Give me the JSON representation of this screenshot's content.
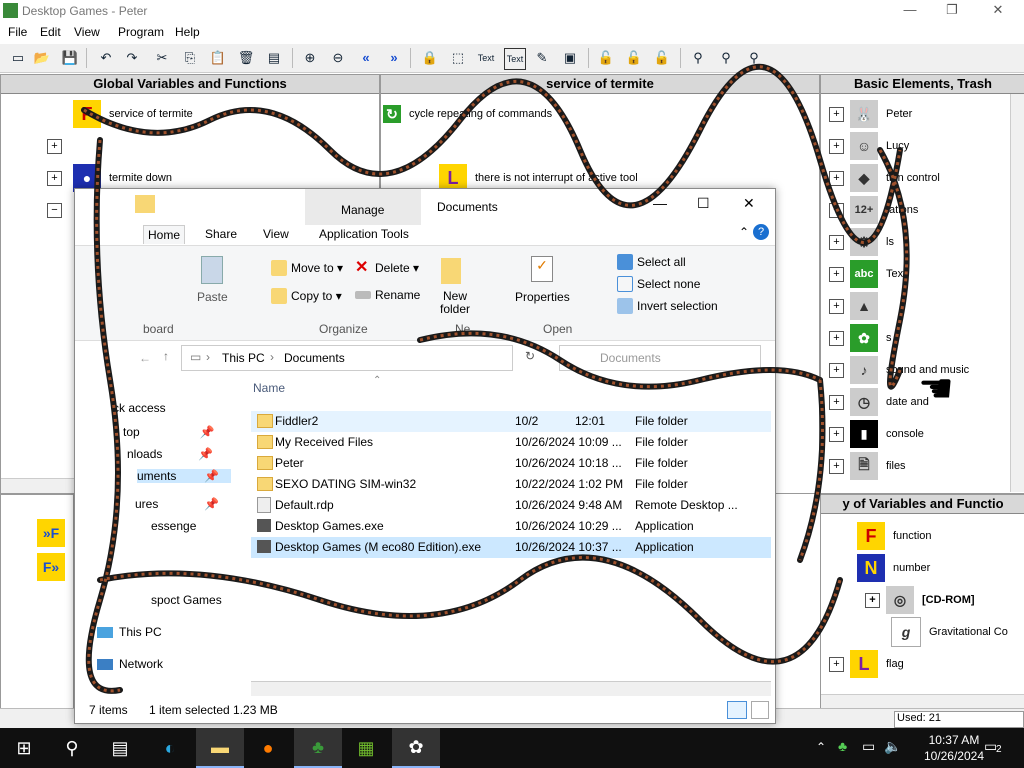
{
  "window": {
    "title": "Desktop Games - Peter",
    "minimize": "—",
    "restore": "❐",
    "close": "✕"
  },
  "menu": [
    "File",
    "Edit",
    "View",
    "Program",
    "Help"
  ],
  "panels": {
    "global": {
      "title": "Global Variables and Functions",
      "items": [
        "service of termite",
        "termite down"
      ]
    },
    "service": {
      "title": "service of termite",
      "items": [
        "cycle repeating of commands",
        "there is not interrupt of active tool"
      ]
    },
    "basic": {
      "title": "Basic Elements, Trash",
      "items": [
        "Peter",
        "Lucy",
        "tion control",
        "tations",
        "ls",
        "Text",
        "",
        "s",
        "sound and music",
        "date and",
        "console",
        "files"
      ]
    },
    "library": {
      "title": "y of Variables and Functio",
      "items": [
        "function",
        "number",
        "[CD-ROM]",
        "Gravitational Co",
        "flag"
      ]
    },
    "used": "Used: 21"
  },
  "explorer": {
    "ribbon_context": "Manage",
    "title": "Documents",
    "tabs": [
      "Home",
      "Share",
      "View",
      "Application Tools"
    ],
    "commands": {
      "paste": "Paste",
      "move_to": "Move to",
      "copy_to": "Copy to",
      "delete": "Delete",
      "rename": "Rename",
      "new_folder": "New folder",
      "properties": "Properties",
      "select_all": "Select all",
      "select_none": "Select none",
      "invert_selection": "Invert selection"
    },
    "groups": [
      "Organize",
      "Open"
    ],
    "groups_partial": [
      "board",
      "Ne"
    ],
    "address": [
      "This PC",
      "Documents"
    ],
    "search_placeholder": "Documents",
    "column_name": "Name",
    "nav": [
      "ck access",
      "top",
      "nloads",
      "uments",
      "ures",
      "essenge",
      "This PC",
      "Network",
      "spoct Games"
    ],
    "files": [
      {
        "name": "Fiddler2",
        "date": "10/2",
        "type": "File folder",
        "time_tail": "12:01"
      },
      {
        "name": "My Received Files",
        "date": "10/26/2024 10:09 ...",
        "type": "File folder"
      },
      {
        "name": "Peter",
        "date": "10/26/2024 10:18 ...",
        "type": "File folder"
      },
      {
        "name": "SEXO DATING SIM-win32",
        "date": "10/22/2024 1:02 PM",
        "type": "File folder"
      },
      {
        "name": "Default.rdp",
        "date": "10/26/2024 9:48 AM",
        "type": "Remote Desktop ..."
      },
      {
        "name": "Desktop Games.exe",
        "date": "10/26/2024 10:29 ...",
        "type": "Application"
      },
      {
        "name": "Desktop Games (M    eco80 Edition).exe",
        "date": "10/26/2024 10:37 ...",
        "type": "Application"
      }
    ],
    "status": {
      "count": "7 items",
      "selected": "1 item selected  1.23 MB"
    }
  },
  "taskbar": {
    "time": "10:37 AM",
    "date": "10/26/2024",
    "notifications": "2"
  }
}
